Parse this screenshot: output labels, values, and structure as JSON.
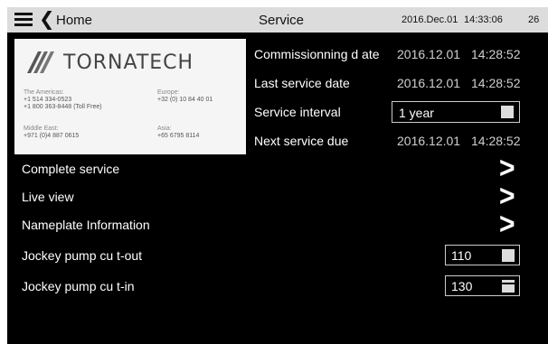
{
  "header": {
    "home_label": "Home",
    "title": "Service",
    "date": "2016.Dec.01",
    "time": "14:33:06",
    "clipped": "26"
  },
  "card": {
    "brand": "TORNATECH",
    "contacts": [
      {
        "title": "The Americas:",
        "lines": [
          "+1 514 334-0523",
          "+1 800 363-8448 (Toll Free)"
        ]
      },
      {
        "title": "Europe:",
        "lines": [
          "+32 (0) 10 84 40 01"
        ]
      },
      {
        "title": "Middle East:",
        "lines": [
          "+971 (0)4 887 0615"
        ]
      },
      {
        "title": "Asia:",
        "lines": [
          "+65 6795 8114"
        ]
      }
    ]
  },
  "info": {
    "commissioning_label": "Commissionning d ate",
    "commissioning_date": "2016.12.01",
    "commissioning_time": "14:28:52",
    "last_service_label": "Last service date",
    "last_service_date": "2016.12.01",
    "last_service_time": "14:28:52",
    "interval_label": "Service interval",
    "interval_value": "1 year",
    "next_due_label": "Next service due",
    "next_due_date": "2016.12.01",
    "next_due_time": "14:28:52"
  },
  "rows": {
    "complete_service": "Complete service",
    "live_view": "Live view",
    "nameplate": "Nameplate Information",
    "cut_out_label": "Jockey pump cu t-out",
    "cut_out_value": "110",
    "cut_in_label": "Jockey pump cu t-in",
    "cut_in_value": "130"
  },
  "icons": {
    "menu": "menu-icon",
    "back": "chevron-left-icon",
    "forward": "chevron-right-icon"
  },
  "colors": {
    "header_bg": "#dcdcdc",
    "screen_bg": "#000000",
    "card_bg": "#f5f5f5"
  }
}
